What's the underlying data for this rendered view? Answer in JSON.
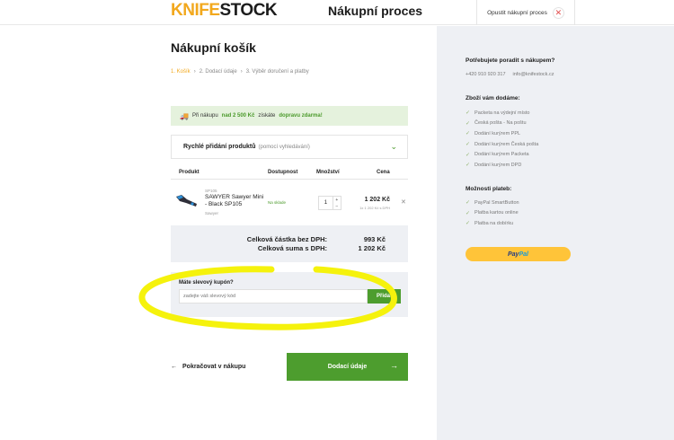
{
  "header": {
    "logo_k": "KNIFE",
    "logo_s": "STOCK",
    "title": "Nákupní proces",
    "exit_label": "Opustit nákupní proces",
    "exit_icon": "close-icon"
  },
  "main": {
    "title": "Nákupní košík",
    "steps": [
      "1. Košík",
      "2. Dodací údaje",
      "3. Výběr doručení a platby"
    ],
    "free_shipping": {
      "prefix": "Při nákupu",
      "amount": "nad 2 500 Kč",
      "middle": "získáte",
      "highlight": "dopravu zdarma!"
    },
    "quick_add": {
      "label": "Rychlé přidání produktů",
      "hint": "(pomocí vyhledávání)"
    },
    "table": {
      "headers": [
        "Produkt",
        "Dostupnost",
        "Množství",
        "Cena"
      ],
      "rows": [
        {
          "code": "SP105",
          "name": "SAWYER Sawyer Mini - Black SP105",
          "brand": "Sawyer",
          "availability": "Na sklade",
          "quantity": "1",
          "price": "1 202 Kč",
          "unit_price": "1x 1 202 Kč s DPH"
        }
      ]
    },
    "totals": {
      "without_vat_label": "Celková částka bez DPH:",
      "without_vat_value": "993 Kč",
      "with_vat_label": "Celková suma s DPH:",
      "with_vat_value": "1 202 Kč"
    },
    "coupon": {
      "label": "Máte slevový kupón?",
      "placeholder": "zadejte váš slevový kód",
      "button": "Přidat"
    },
    "back_label": "Pokračovat v nákupu",
    "next_label": "Dodací údaje"
  },
  "sidebar": {
    "advice_heading": "Potřebujete poradit s nákupem?",
    "phone": "+420 910 920 317",
    "email": "info@knifestock.cz",
    "delivery_heading": "Zboží vám dodáme:",
    "delivery_options": [
      "Packeta na výdejní místo",
      "Česká pošta - Na poštu",
      "Dodání kurýrem PPL",
      "Dodání kurýrem Česká pošta",
      "Dodání kurýrem Packeta",
      "Dodání kurýrem DPD"
    ],
    "payment_heading": "Možnosti plateb:",
    "payment_options": [
      "PayPal SmartButton",
      "Platba kartou online",
      "Platba na dobírku"
    ],
    "paypal_p1": "Pay",
    "paypal_p2": "Pal",
    "colors": {
      "accent_green": "#4d9d2e",
      "logo_orange": "#f2a81d",
      "paypal_yellow": "#ffc439"
    }
  }
}
